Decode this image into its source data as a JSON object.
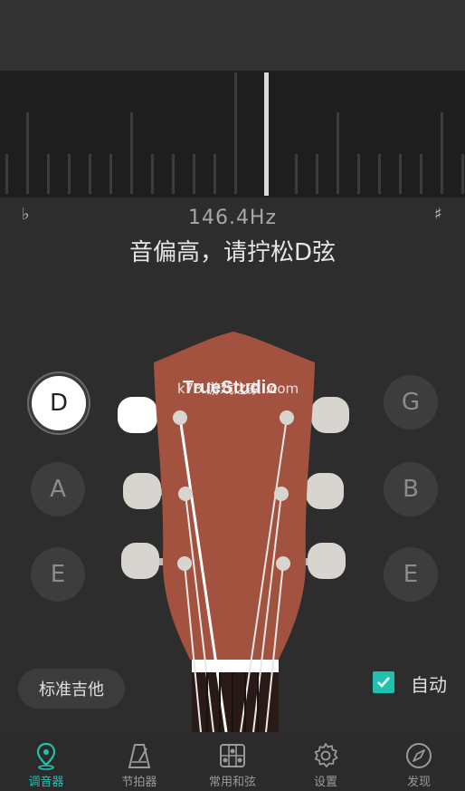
{
  "tuner": {
    "frequency": "146.4Hz",
    "hint": "音偏高，请拧松D弦",
    "flat_symbol": "♭",
    "sharp_symbol": "♯"
  },
  "strings": {
    "left": [
      {
        "note": "D",
        "active": true
      },
      {
        "note": "A",
        "active": false
      },
      {
        "note": "E",
        "active": false
      }
    ],
    "right": [
      {
        "note": "G",
        "active": false
      },
      {
        "note": "B",
        "active": false
      },
      {
        "note": "E",
        "active": false
      }
    ]
  },
  "headstock": {
    "brand_text": "TrueStudio",
    "watermark": "k73 游戏之家 .com"
  },
  "controls": {
    "preset_label": "标准吉他",
    "auto_label": "自动",
    "auto_checked": true
  },
  "tabs": [
    {
      "label": "调音器",
      "icon": "tuner-pin-icon",
      "active": true
    },
    {
      "label": "节拍器",
      "icon": "metronome-icon",
      "active": false
    },
    {
      "label": "常用和弦",
      "icon": "chord-grid-icon",
      "active": false
    },
    {
      "label": "设置",
      "icon": "gear-icon",
      "active": false
    },
    {
      "label": "发现",
      "icon": "compass-icon",
      "active": false
    }
  ],
  "colors": {
    "accent": "#1fc2b0",
    "background": "#2d2d2d",
    "headstock": "#a3523f"
  }
}
